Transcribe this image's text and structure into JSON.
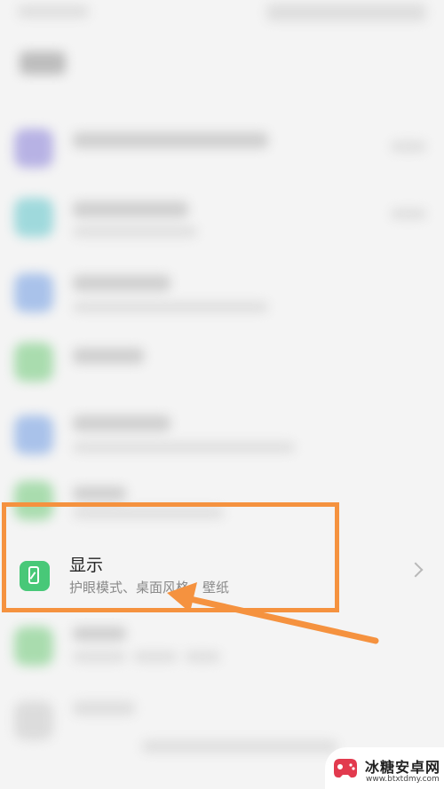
{
  "settings": {
    "display": {
      "title": "显示",
      "subtitle": "护眼模式、桌面风格、壁纸"
    }
  },
  "watermark": {
    "title": "冰糖安卓网",
    "url": "www.btxtdmy.com"
  },
  "colors": {
    "highlight": "#f5923f",
    "display_icon": "#48c878"
  },
  "icons": {
    "display": "display-phone-icon",
    "chevron": "chevron-right-icon",
    "watermark_logo": "game-controller-logo"
  }
}
